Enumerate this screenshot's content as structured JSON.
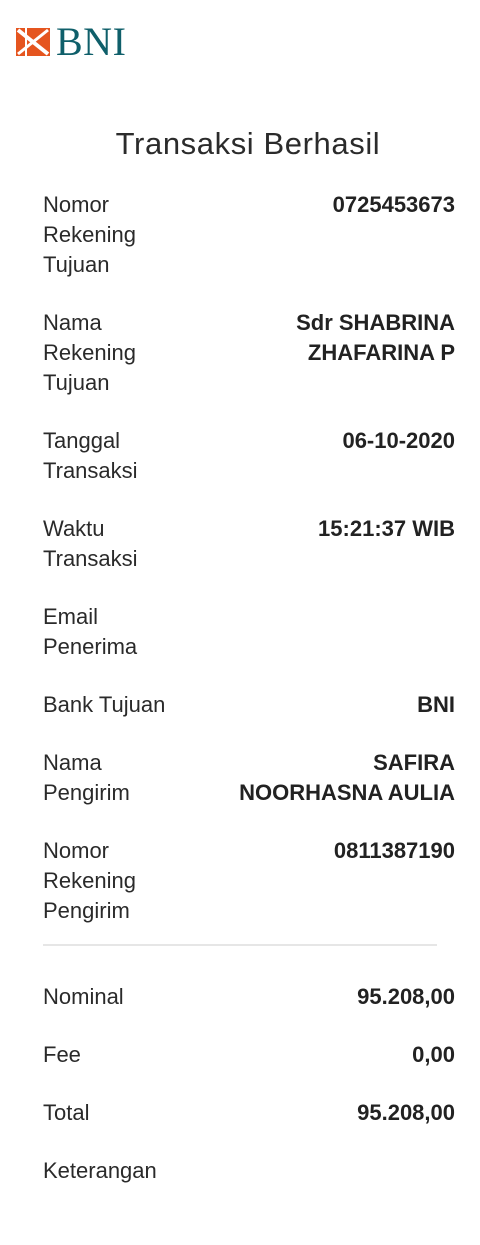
{
  "brand": {
    "name": "BNI",
    "mark_color": "#e5551f",
    "text_color": "#0f5f6a"
  },
  "title": "Transaksi Berhasil",
  "details": [
    {
      "label": "Nomor Rekening Tujuan",
      "value": "0725453673"
    },
    {
      "label": "Nama Rekening Tujuan",
      "value": "Sdr SHABRINA ZHAFARINA P"
    },
    {
      "label": "Tanggal Transaksi",
      "value": "06-10-2020"
    },
    {
      "label": "Waktu Transaksi",
      "value": "15:21:37 WIB"
    },
    {
      "label": "Email Penerima",
      "value": ""
    },
    {
      "label": "Bank Tujuan",
      "value": "BNI"
    },
    {
      "label": "Nama Pengirim",
      "value": "SAFIRA NOORHASNA AULIA"
    },
    {
      "label": "Nomor Rekening Pengirim",
      "value": "0811387190"
    }
  ],
  "summary": [
    {
      "label": "Nominal",
      "value": "95.208,00"
    },
    {
      "label": "Fee",
      "value": "0,00"
    },
    {
      "label": "Total",
      "value": "95.208,00"
    },
    {
      "label": "Keterangan",
      "value": ""
    }
  ]
}
